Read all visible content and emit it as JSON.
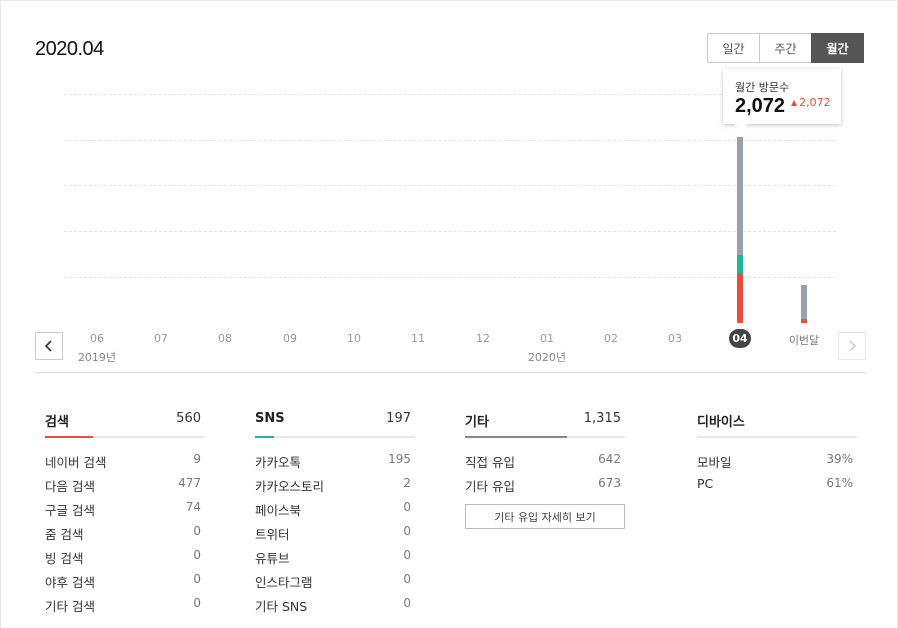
{
  "header": {
    "period": "2020.04"
  },
  "tabs": [
    {
      "label": "일간",
      "active": false
    },
    {
      "label": "주간",
      "active": false
    },
    {
      "label": "월간",
      "active": true
    }
  ],
  "tooltip": {
    "label": "월간 방문수",
    "value": "2,072",
    "delta": "2,072",
    "delta_direction": "up"
  },
  "chart_data": {
    "type": "bar",
    "stacked": true,
    "categories": [
      "06",
      "07",
      "08",
      "09",
      "10",
      "11",
      "12",
      "01",
      "02",
      "03",
      "04",
      "이번달"
    ],
    "year_labels": [
      {
        "text": "2019년"
      },
      {
        "text": "2020년"
      }
    ],
    "selected": "04",
    "series": [
      {
        "color": "#f04b3a",
        "values": [
          0,
          0,
          0,
          0,
          0,
          0,
          0,
          0,
          0,
          0,
          560,
          40
        ]
      },
      {
        "color": "#1fb5a3",
        "values": [
          0,
          0,
          0,
          0,
          0,
          0,
          0,
          0,
          0,
          0,
          197,
          0
        ]
      },
      {
        "color": "#9aa1a8",
        "values": [
          0,
          0,
          0,
          0,
          0,
          0,
          0,
          0,
          0,
          0,
          1315,
          380
        ]
      }
    ],
    "ylim": [
      0,
      2550
    ],
    "grid": true
  },
  "colors": {
    "search": "#f04b3a",
    "sns": "#1fb5a3",
    "other": "#888888",
    "accent_up": "#f04b3a"
  },
  "icons": {
    "prev": "chevron-left-icon",
    "next": "chevron-right-icon"
  },
  "categories": {
    "search": {
      "title": "검색",
      "total": "560",
      "bar_fraction": 0.3,
      "rows": [
        {
          "label": "네이버 검색",
          "value": "9"
        },
        {
          "label": "다음 검색",
          "value": "477"
        },
        {
          "label": "구글 검색",
          "value": "74"
        },
        {
          "label": "줌 검색",
          "value": "0"
        },
        {
          "label": "빙 검색",
          "value": "0"
        },
        {
          "label": "야후 검색",
          "value": "0"
        },
        {
          "label": "기타 검색",
          "value": "0"
        }
      ]
    },
    "sns": {
      "title": "SNS",
      "total": "197",
      "bar_fraction": 0.12,
      "rows": [
        {
          "label": "카카오톡",
          "value": "195"
        },
        {
          "label": "카카오스토리",
          "value": "2"
        },
        {
          "label": "페이스북",
          "value": "0"
        },
        {
          "label": "트위터",
          "value": "0"
        },
        {
          "label": "유튜브",
          "value": "0"
        },
        {
          "label": "인스타그램",
          "value": "0"
        },
        {
          "label": "기타 SNS",
          "value": "0"
        }
      ]
    },
    "other": {
      "title": "기타",
      "total": "1,315",
      "bar_fraction": 0.64,
      "rows": [
        {
          "label": "직접 유입",
          "value": "642"
        },
        {
          "label": "기타 유입",
          "value": "673"
        }
      ],
      "more_label": "기타 유입 자세히 보기"
    },
    "device": {
      "title": "디바이스",
      "rows": [
        {
          "label": "모바일",
          "value": "39%"
        },
        {
          "label": "PC",
          "value": "61%"
        }
      ]
    }
  }
}
